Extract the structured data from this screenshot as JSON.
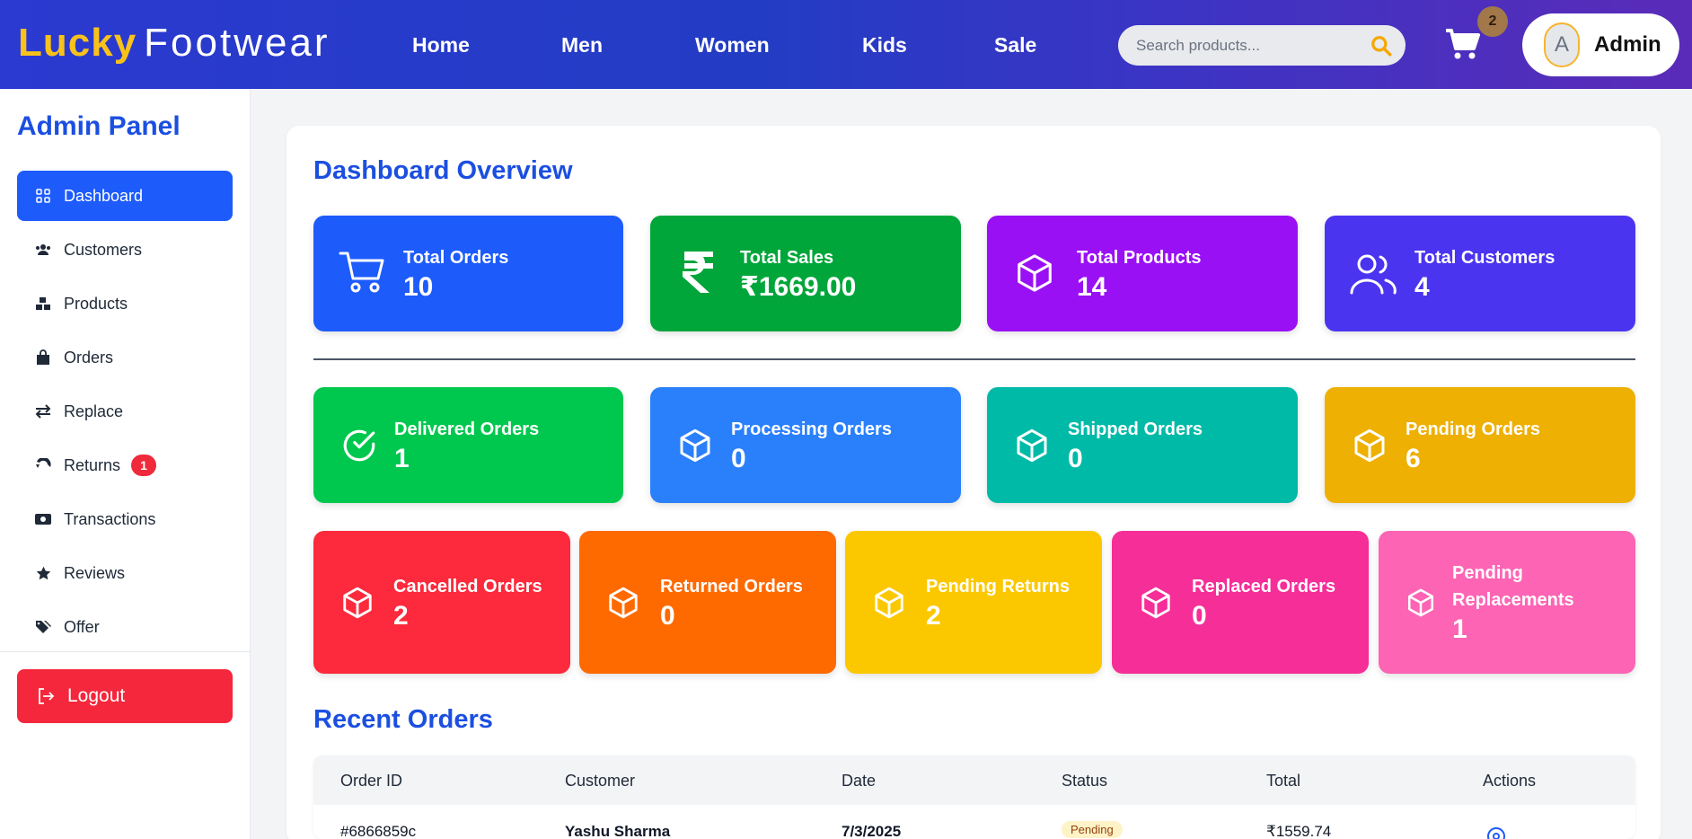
{
  "brand": {
    "word1": "Lucky",
    "word2": "Footwear"
  },
  "nav": [
    "Home",
    "Men",
    "Women",
    "Kids",
    "Sale"
  ],
  "search": {
    "placeholder": "Search products..."
  },
  "cart": {
    "count": "2"
  },
  "user": {
    "avatar_letter": "A",
    "name": "Admin"
  },
  "sidebar": {
    "title": "Admin Panel",
    "items": [
      {
        "label": "Dashboard",
        "icon": "dashboard-icon"
      },
      {
        "label": "Customers",
        "icon": "users-icon"
      },
      {
        "label": "Products",
        "icon": "boxes-icon"
      },
      {
        "label": "Orders",
        "icon": "shopping-bag-icon"
      },
      {
        "label": "Replace",
        "icon": "exchange-icon"
      },
      {
        "label": "Returns",
        "icon": "return-icon",
        "badge": "1"
      },
      {
        "label": "Transactions",
        "icon": "money-icon"
      },
      {
        "label": "Reviews",
        "icon": "star-icon"
      },
      {
        "label": "Offer",
        "icon": "tags-icon"
      }
    ],
    "logout": "Logout"
  },
  "dashboard": {
    "title": "Dashboard Overview",
    "stats": [
      {
        "label": "Total Orders",
        "value": "10",
        "color": "#1d5bfb",
        "icon": "cart-icon"
      },
      {
        "label": "Total Sales",
        "value": "₹1669.00",
        "color": "#01a63a",
        "icon": "rupee-icon"
      },
      {
        "label": "Total Products",
        "value": "14",
        "color": "#9a10f5",
        "icon": "box-icon"
      },
      {
        "label": "Total Customers",
        "value": "4",
        "color": "#4b34f0",
        "icon": "users-icon"
      }
    ],
    "status_cards": [
      {
        "label": "Delivered Orders",
        "value": "1",
        "color": "#00c84e",
        "icon": "check-circle-icon"
      },
      {
        "label": "Processing Orders",
        "value": "0",
        "color": "#2a80fb",
        "icon": "box-icon"
      },
      {
        "label": "Shipped Orders",
        "value": "0",
        "color": "#00baa8",
        "icon": "box-icon"
      },
      {
        "label": "Pending Orders",
        "value": "6",
        "color": "#edb003",
        "icon": "box-icon"
      }
    ],
    "other_cards": [
      {
        "label": "Cancelled Orders",
        "value": "2",
        "color": "#fc2a3c",
        "icon": "box-icon"
      },
      {
        "label": "Returned Orders",
        "value": "0",
        "color": "#fe6a00",
        "icon": "box-icon"
      },
      {
        "label": "Pending Returns",
        "value": "2",
        "color": "#fbc800",
        "icon": "box-icon"
      },
      {
        "label": "Replaced Orders",
        "value": "0",
        "color": "#f62e98",
        "icon": "box-icon"
      },
      {
        "label": "Pending Replacements",
        "value": "1",
        "color": "#fd64b4",
        "icon": "box-icon"
      }
    ]
  },
  "recent_orders": {
    "title": "Recent Orders",
    "columns": [
      "Order ID",
      "Customer",
      "Date",
      "Status",
      "Total",
      "Actions"
    ],
    "rows": [
      {
        "order_id": "#6866859c",
        "customer": "Yashu Sharma",
        "date": "7/3/2025",
        "status": "Pending",
        "total": "₹1559.74"
      }
    ]
  }
}
